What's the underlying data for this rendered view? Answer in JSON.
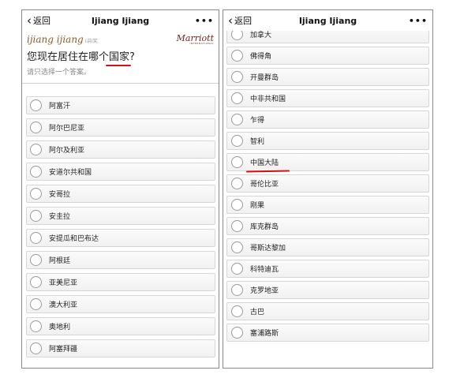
{
  "left": {
    "nav": {
      "back_label": "返回",
      "title": "Ijiang Ijiang",
      "more": "•••"
    },
    "brand": {
      "logo": "ijiang ijiang",
      "logo_sub": "i讲i奖",
      "partner": "Marriott",
      "partner_sub": "INTERNATIONAL"
    },
    "question": {
      "prefix": "您现在居住在哪个",
      "highlight": "国家",
      "suffix": "?"
    },
    "hint": "请只选择一个答案。",
    "options": [
      "阿富汗",
      "阿尔巴尼亚",
      "阿尔及利亚",
      "安道尔共和国",
      "安哥拉",
      "安圭拉",
      "安提瓜和巴布达",
      "阿根廷",
      "亚美尼亚",
      "澳大利亚",
      "奥地利",
      "阿塞拜疆"
    ]
  },
  "right": {
    "nav": {
      "back_label": "返回",
      "title": "Ijiang Ijiang",
      "more": "•••"
    },
    "options": [
      "加拿大",
      "佛得角",
      "开曼群岛",
      "中非共和国",
      "乍得",
      "智利",
      "中国大陆",
      "哥伦比亚",
      "刚果",
      "库克群岛",
      "哥斯达黎加",
      "科特迪瓦",
      "克罗地亚",
      "古巴",
      "塞浦路斯"
    ],
    "highlighted_option": "中国大陆"
  },
  "colors": {
    "annotation_red": "#d0101a",
    "brand_brown": "#8b5a2b",
    "marriott_red": "#7a1b1b"
  }
}
